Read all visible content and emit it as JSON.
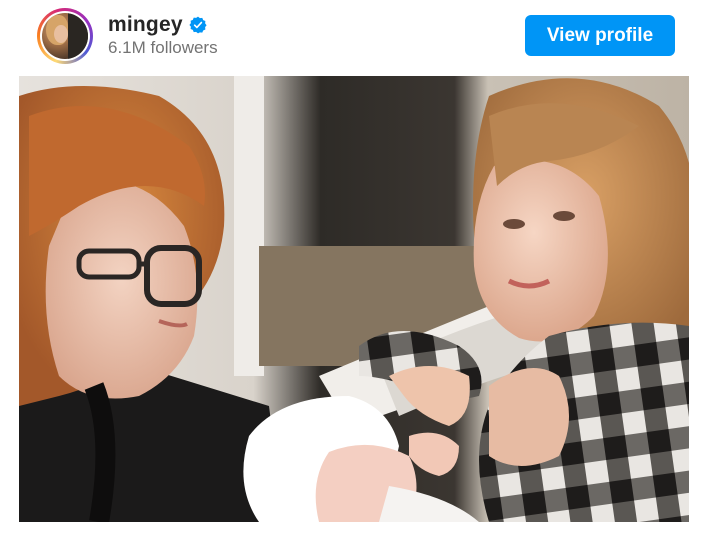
{
  "post": {
    "username": "mingey",
    "verified": true,
    "followers_text": "6.1M followers",
    "view_profile_label": "View profile",
    "accent_color": "#0095f6"
  },
  "icons": {
    "avatar": "profile-picture",
    "verified": "verified-badge-icon"
  }
}
